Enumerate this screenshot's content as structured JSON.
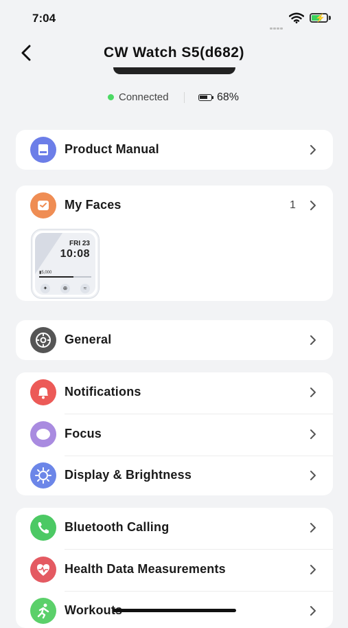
{
  "status_bar": {
    "time": "7:04"
  },
  "header": {
    "title": "CW Watch S5(d682)"
  },
  "device": {
    "connection": "Connected",
    "battery": "68%"
  },
  "product_manual": {
    "label": "Product Manual"
  },
  "my_faces": {
    "label": "My Faces",
    "count": "1",
    "face": {
      "date": "FRI 23",
      "time": "10:08",
      "steps": "5,000"
    }
  },
  "general": {
    "label": "General"
  },
  "display_group": {
    "items": [
      {
        "label": "Notifications"
      },
      {
        "label": "Focus"
      },
      {
        "label": "Display & Brightness"
      }
    ]
  },
  "health_group": {
    "items": [
      {
        "label": "Bluetooth Calling"
      },
      {
        "label": "Health Data Measurements"
      },
      {
        "label": "Workouts"
      }
    ]
  },
  "colors": {
    "product_manual": "#6c7ee8",
    "my_faces": "#ef8d54",
    "general": "#555555",
    "notifications": "#ec5a57",
    "focus": "#a98be0",
    "display": "#6c86e8",
    "bluetooth": "#4cc964",
    "health": "#e45a62",
    "workouts": "#5bd06a",
    "connected": "#4cd964"
  }
}
